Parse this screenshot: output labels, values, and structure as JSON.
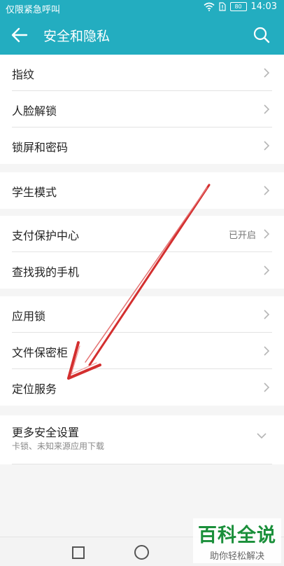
{
  "status_bar": {
    "left_text": "仅限紧急呼叫",
    "time": "14:03",
    "battery": "80"
  },
  "header": {
    "title": "安全和隐私",
    "back_icon": "arrow-left-icon",
    "search_icon": "search-icon"
  },
  "groups": [
    {
      "items": [
        {
          "label": "指纹"
        },
        {
          "label": "人脸解锁"
        },
        {
          "label": "锁屏和密码"
        }
      ]
    },
    {
      "items": [
        {
          "label": "学生模式"
        }
      ]
    },
    {
      "items": [
        {
          "label": "支付保护中心",
          "value": "已开启"
        },
        {
          "label": "查找我的手机"
        }
      ]
    },
    {
      "items": [
        {
          "label": "应用锁"
        },
        {
          "label": "文件保密柜"
        },
        {
          "label": "定位服务"
        }
      ]
    }
  ],
  "more": {
    "label": "更多安全设置",
    "subtitle": "卡锁、未知来源应用下载"
  },
  "watermark": {
    "title": "百科全说",
    "subtitle": "助你轻松解决"
  },
  "colors": {
    "accent": "#23adc0",
    "annotation_arrow": "#d32f2f"
  }
}
